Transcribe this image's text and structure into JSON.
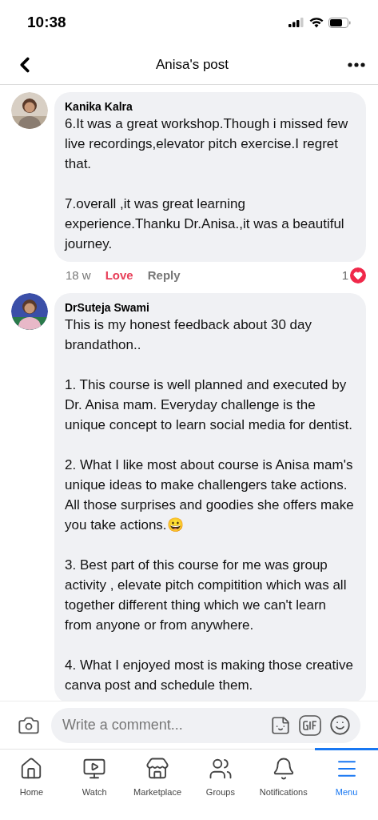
{
  "status_bar": {
    "time": "10:38"
  },
  "header": {
    "title": "Anisa's post"
  },
  "comments": [
    {
      "author": "Kanika Kalra",
      "paragraphs": [
        "6.It was a great workshop.Though i missed few live recordings,elevator pitch exercise.I regret that.",
        "7.overall ,it was great learning experience.Thanku Dr.Anisa.,it was a beautiful journey."
      ],
      "time": "18 w",
      "love": "Love",
      "loved": true,
      "reply": "Reply",
      "reaction_count": "1"
    },
    {
      "author": "DrSuteja Swami",
      "paragraphs": [
        "This is my honest feedback about 30 day brandathon..",
        "1. This course is well planned and executed by Dr.  Anisa mam. Everyday challenge is the unique concept to learn social media for dentist.",
        "2. What I like most about course is Anisa mam's unique ideas to make challengers  take actions. All those surprises and goodies she offers make you take actions.😀",
        "3. Best part of this course for me was group activity , elevate pitch compitition which was all together different thing which we can't learn from anyone or from anywhere.",
        "4. What I enjoyed most is making those creative canva post and schedule them."
      ]
    }
  ],
  "composer": {
    "placeholder": "Write a comment..."
  },
  "tabs": [
    {
      "label": "Home",
      "selected": false
    },
    {
      "label": "Watch",
      "selected": false
    },
    {
      "label": "Marketplace",
      "selected": false
    },
    {
      "label": "Groups",
      "selected": false
    },
    {
      "label": "Notifications",
      "selected": false
    },
    {
      "label": "Menu",
      "selected": true
    }
  ]
}
